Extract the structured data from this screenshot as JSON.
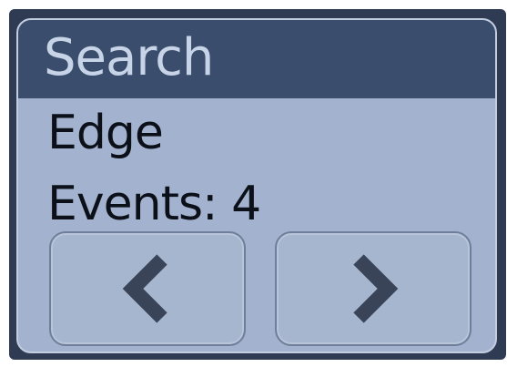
{
  "panel": {
    "title": "Search",
    "type_label": "Edge",
    "events_label": "Events: 4"
  },
  "buttons": {
    "prev_icon": "chevron-left-icon",
    "next_icon": "chevron-right-icon"
  },
  "colors": {
    "header": "#3a4d6c",
    "panel": "#a3b3cf",
    "frame": "#2e3b52",
    "icon": "#3a4458"
  }
}
